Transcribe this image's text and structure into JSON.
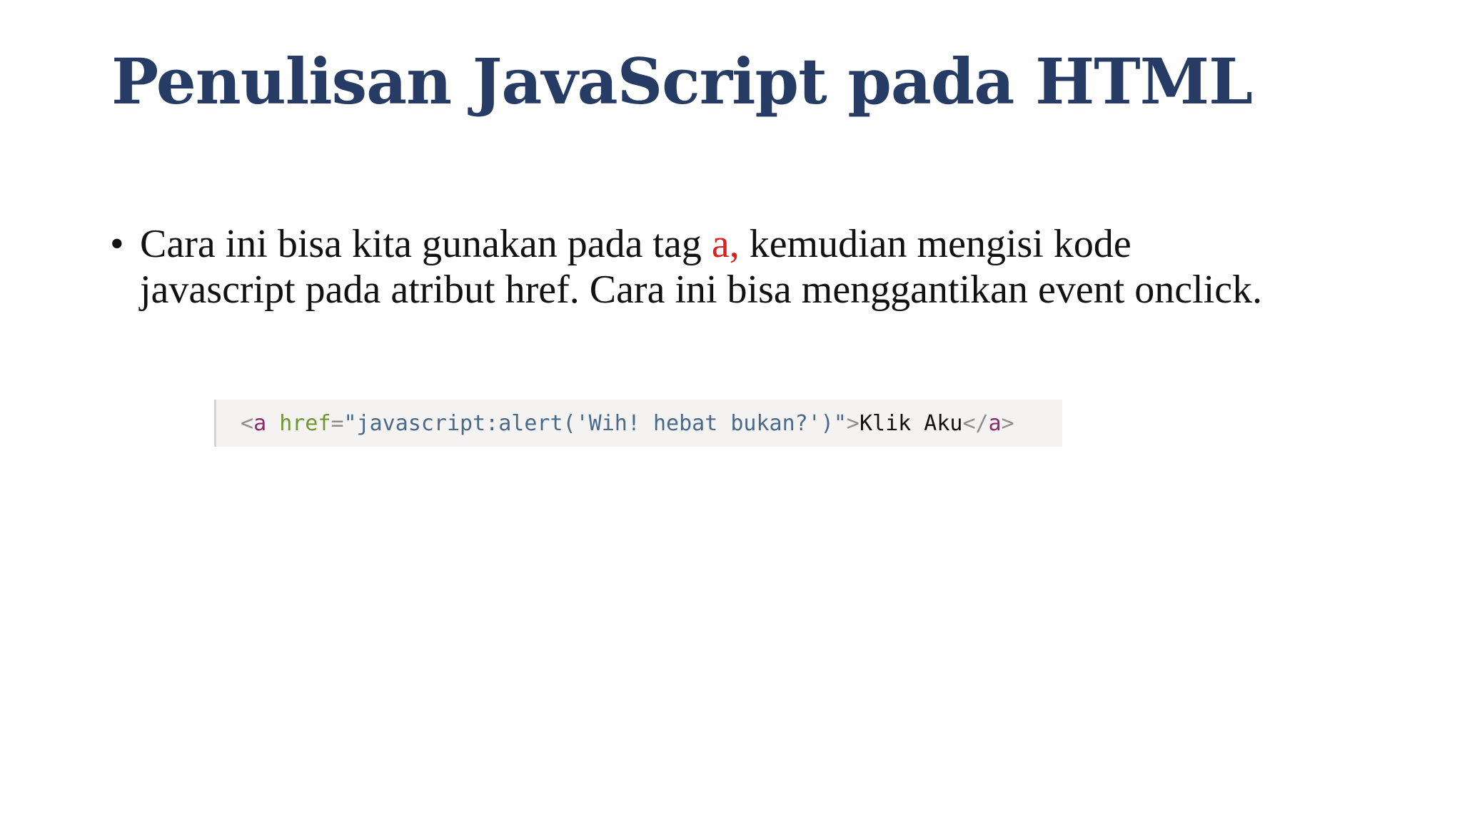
{
  "slide": {
    "title": "Penulisan JavaScript pada HTML",
    "bullet": {
      "marker": "•",
      "text_before": "Cara ini bisa kita gunakan pada tag ",
      "highlight": "a,",
      "text_after": " kemudian mengisi kode javascript pada atribut href. Cara ini bisa menggantikan event onclick."
    },
    "code": {
      "open_bracket": "<",
      "tag_name": "a",
      "space": " ",
      "attr_name": "href",
      "equals": "=",
      "attr_value": "\"javascript:alert('Wih! hebat bukan?')\"",
      "close_bracket": ">",
      "inner_text": "Klik Aku",
      "closing_open": "</",
      "closing_tag": "a",
      "closing_close": ">"
    }
  },
  "colors": {
    "title": "#263c64",
    "highlight": "#e01f1f",
    "code_background": "#f4f3f2"
  }
}
